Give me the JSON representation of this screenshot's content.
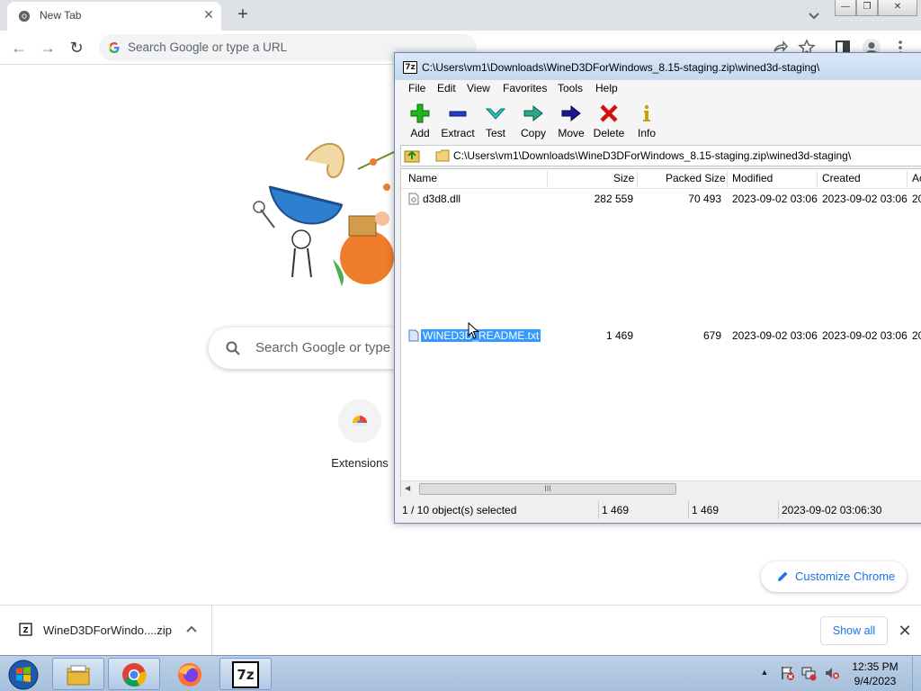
{
  "chrome": {
    "tab": {
      "title": "New Tab",
      "close_glyph": "✕"
    },
    "new_tab_glyph": "+",
    "window_controls": {
      "minimize": "—",
      "restore": "❐",
      "close": "✕"
    },
    "nav": {
      "back_glyph": "←",
      "forward_glyph": "→",
      "reload_glyph": "↻"
    },
    "omnibox": {
      "placeholder": "Search Google or type a URL"
    },
    "ntp": {
      "search_placeholder": "Search Google or type a URL",
      "shortcut_label": "Extensions",
      "customize_label": "Customize Chrome"
    },
    "download_bar": {
      "filename": "WineD3DForWindo....zip",
      "show_all_label": "Show all",
      "close_glyph": "✕"
    }
  },
  "zip": {
    "title": "C:\\Users\\vm1\\Downloads\\WineD3DForWindows_8.15-staging.zip\\wined3d-staging\\",
    "app_icon_text": "7z",
    "menu": [
      "File",
      "Edit",
      "View",
      "Favorites",
      "Tools",
      "Help"
    ],
    "tools": [
      "Add",
      "Extract",
      "Test",
      "Copy",
      "Move",
      "Delete",
      "Info"
    ],
    "address": "C:\\Users\\vm1\\Downloads\\WineD3DForWindows_8.15-staging.zip\\wined3d-staging\\",
    "columns": [
      "Name",
      "Size",
      "Packed Size",
      "Modified",
      "Created",
      "Ac"
    ],
    "rows": [
      {
        "name": "d3d8.dll",
        "size": "282 559",
        "packed": "70 493",
        "modified": "2023-09-02 03:06",
        "created": "2023-09-02 03:06",
        "accessed": "20"
      },
      {
        "name": "WINED3D_README.txt",
        "size": "1 469",
        "packed": "679",
        "modified": "2023-09-02 03:06",
        "created": "2023-09-02 03:06",
        "accessed": "20"
      }
    ],
    "scroll_thumb_glyph": "III",
    "scroll_left_glyph": "◀",
    "status": {
      "selected": "1 / 10 object(s) selected",
      "size": "1 469",
      "packed": "1 469",
      "modified": "2023-09-02 03:06:30"
    }
  },
  "taskbar": {
    "items": [
      "windows-explorer",
      "google-chrome",
      "firefox",
      "7-zip"
    ],
    "sevenzip_label": "7z",
    "tray_arrow_glyph": "▲",
    "time": "12:35 PM",
    "date": "9/4/2023"
  },
  "colors": {
    "selection": "#3399ff",
    "accent_blue": "#1a73e8",
    "taskbar": "#a7c0dc"
  }
}
